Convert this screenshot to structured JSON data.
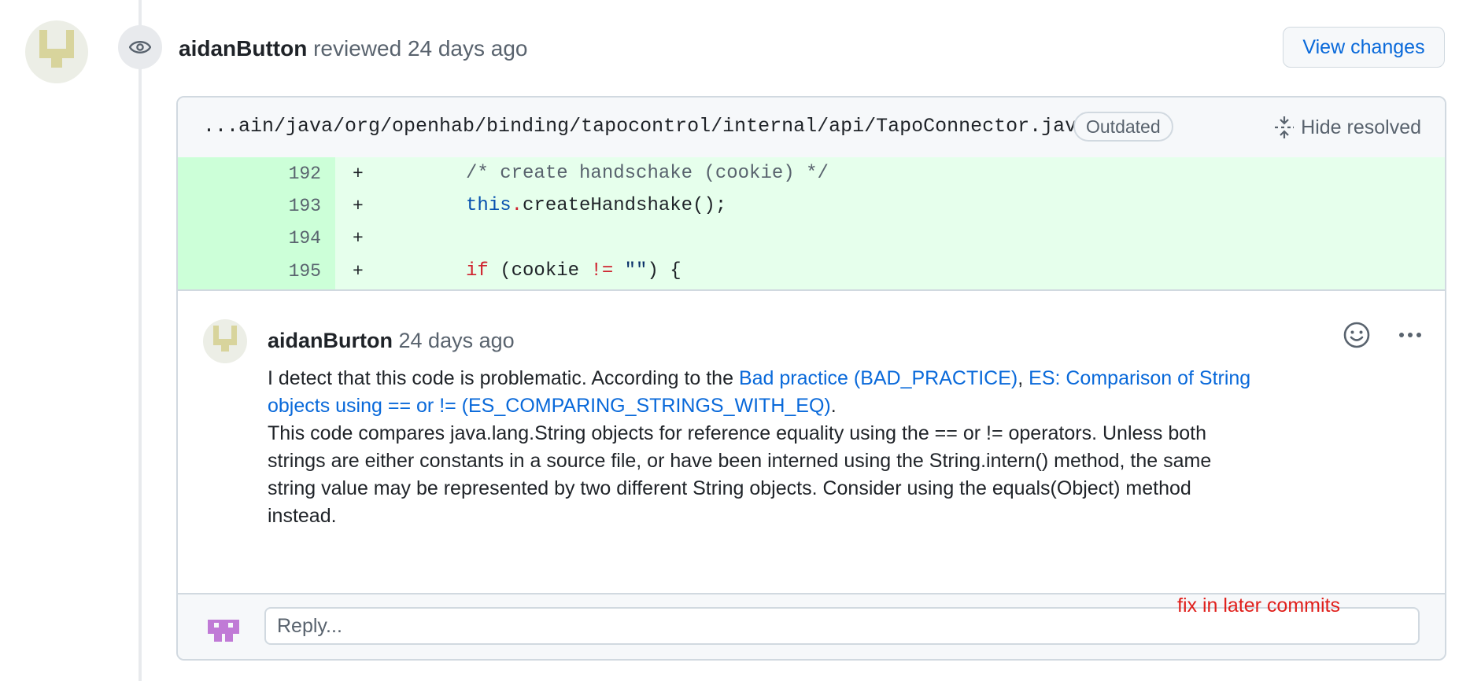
{
  "review": {
    "author": "aidanButton",
    "action": "reviewed",
    "time": "24 days ago",
    "view_changes_label": "View changes"
  },
  "file": {
    "path": "...ain/java/org/openhab/binding/tapocontrol/internal/api/TapoConnector.java",
    "status_badge": "Outdated",
    "hide_resolved_label": "Hide resolved"
  },
  "diff": {
    "lines": [
      {
        "number": "192",
        "sign": "+",
        "code": "/* create handschake (cookie) */"
      },
      {
        "number": "193",
        "sign": "+",
        "code": "this.createHandshake();"
      },
      {
        "number": "194",
        "sign": "+",
        "code": ""
      },
      {
        "number": "195",
        "sign": "+",
        "code": "if (cookie != \"\") {"
      }
    ]
  },
  "comment": {
    "author": "aidanBurton",
    "time": "24 days ago",
    "intro": "I detect that this code is problematic. According to the",
    "link1": "Bad practice (BAD_PRACTICE)",
    "separator": ",",
    "link2": "ES: Comparison of String objects using == or != (ES_COMPARING_STRINGS_WITH_EQ)",
    "period": ".",
    "body": "This code compares java.lang.String objects for reference equality using the == or != operators. Unless both strings are either constants in a source file, or have been interned using the String.intern() method, the same string value may be represented by two different String objects. Consider using the equals(Object) method instead."
  },
  "reply": {
    "placeholder": "Reply..."
  },
  "annotation": {
    "text": "fix in later commits",
    "color": "#e0201c"
  },
  "colors": {
    "link": "#0969da",
    "diff_added_bg": "#e6ffec",
    "diff_added_gutter": "#ccffd8"
  },
  "icons": {
    "review_badge": "eye-icon",
    "hide_resolved": "fold-icon",
    "reaction": "smiley-icon",
    "more": "kebab-horizontal-icon"
  }
}
